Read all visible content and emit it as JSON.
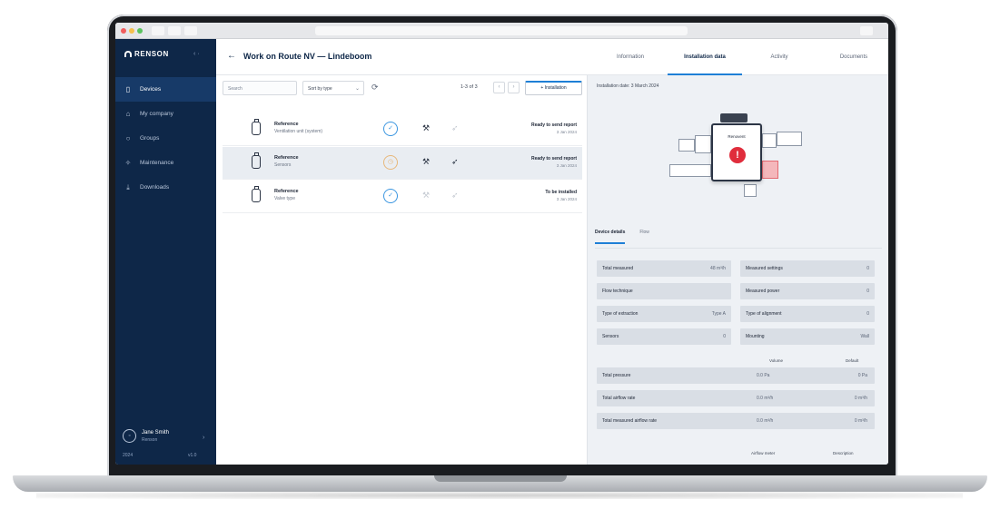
{
  "app": {
    "brand": "RENSON",
    "window_title": "Work on Route NV — Lindeboom"
  },
  "sidebar": {
    "collapse_icon": "chevron-left-icon",
    "items": [
      {
        "label": "Devices",
        "icon": "device-icon",
        "active": true
      },
      {
        "label": "My company",
        "icon": "company-icon",
        "active": false
      },
      {
        "label": "Groups",
        "icon": "groups-icon",
        "active": false
      },
      {
        "label": "Maintenance",
        "icon": "maintenance-icon",
        "active": false
      },
      {
        "label": "Downloads",
        "icon": "download-icon",
        "active": false
      }
    ],
    "user": {
      "name": "Jane Smith",
      "company": "Renson"
    },
    "footer_left": "2024",
    "footer_right": "v1.0"
  },
  "header": {
    "back_icon": "arrow-left-icon",
    "tabs": [
      {
        "label": "Information",
        "active": false
      },
      {
        "label": "Installation data",
        "active": true
      },
      {
        "label": "Activity",
        "active": false
      },
      {
        "label": "Documents",
        "active": false
      }
    ]
  },
  "list": {
    "search_placeholder": "Search",
    "filter_value": "Sort by type",
    "pager_text": "1-3 of 3",
    "add_label": "+ Installation",
    "rows": [
      {
        "name": "Reference",
        "sub": "Ventilation unit (system)",
        "state": "Ready to send report",
        "state_sub": "3 Jan 2024",
        "status_icon": "check-circle-icon",
        "warn": false,
        "selected": false
      },
      {
        "name": "Reference",
        "sub": "Sensors",
        "state": "Ready to send report",
        "state_sub": "3 Jan 2024",
        "status_icon": "clock-circle-icon",
        "warn": true,
        "selected": true
      },
      {
        "name": "Reference",
        "sub": "Valve type",
        "state": "To be installed",
        "state_sub": "3 Jan 2024",
        "status_icon": "check-circle-icon",
        "warn": false,
        "selected": false
      }
    ]
  },
  "panel": {
    "installation_date": "Installation date: 3 March 2024",
    "unit_label": "Renovent",
    "alert_symbol": "!",
    "sub_tabs": [
      {
        "label": "Device details",
        "active": true
      },
      {
        "label": "Flow",
        "active": false
      }
    ],
    "fields_left": [
      {
        "label": "Total measured",
        "value": "48 m³/h"
      },
      {
        "label": "Flow technique",
        "value": ""
      },
      {
        "label": "Type of extraction",
        "value": "Type A"
      },
      {
        "label": "Sensors",
        "value": "0"
      }
    ],
    "fields_right": [
      {
        "label": "Measured settings",
        "value": "0"
      },
      {
        "label": "Measured power",
        "value": "0"
      },
      {
        "label": "Type of alignment",
        "value": "0"
      },
      {
        "label": "Mounting",
        "value": "Wall"
      }
    ],
    "col_head_1": "Volume",
    "col_head_2": "Default",
    "wide_rows": [
      {
        "label": "Total pressure",
        "v1": "0.0 Pa",
        "v2": "0 Pa"
      },
      {
        "label": "Total airflow rate",
        "v1": "0.0 m³/h",
        "v2": "0 m³/h"
      },
      {
        "label": "Total measured airflow rate",
        "v1": "0.0 m³/h",
        "v2": "0 m³/h"
      }
    ],
    "bottom_head_1": "Airflow meter",
    "bottom_head_2": "Description"
  },
  "colors": {
    "sidebar": "#0e2748",
    "accent": "#1e7fd6",
    "alert": "#e02d3c",
    "panel": "#eef1f5"
  }
}
